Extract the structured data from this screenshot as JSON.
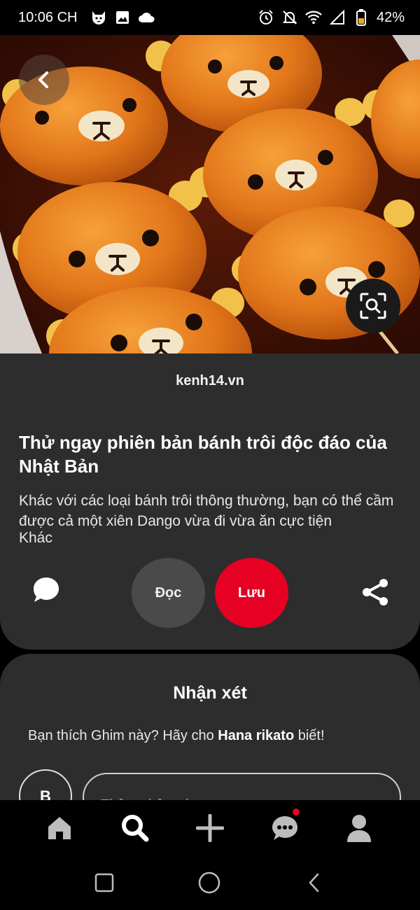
{
  "status_bar": {
    "time": "10:06 CH",
    "battery_percent": "42%",
    "left_icons": [
      "notification-cat-icon",
      "image-icon",
      "cloud-icon"
    ],
    "right_icons": [
      "alarm-icon",
      "bell-off-icon",
      "wifi-icon",
      "signal-icon",
      "battery-icon"
    ]
  },
  "hero": {
    "back_icon": "chevron-left-icon",
    "visual_search_icon": "visual-search-icon"
  },
  "pin": {
    "source": "kenh14.vn",
    "title": "Thử ngay phiên bản bánh trôi độc đáo của Nhật Bản",
    "description": "Khác với các loại bánh trôi thông thường, bạn có thể cầm được cả một xiên Dango vừa đi vừa ăn cực tiện",
    "category": "Khác"
  },
  "actions": {
    "read_label": "Đọc",
    "save_label": "Lưu",
    "comment_icon": "comment-bubble-icon",
    "share_icon": "share-icon"
  },
  "comments": {
    "title": "Nhận xét",
    "prompt_prefix": "Bạn thích Ghim này? Hãy cho ",
    "prompt_user": "Hana rikato",
    "prompt_suffix": " biết!",
    "avatar_initial": "B",
    "input_placeholder": "Thêm nhận xét"
  },
  "bottom_nav": {
    "items": [
      "home-icon",
      "search-icon",
      "add-icon",
      "messages-icon",
      "profile-icon"
    ],
    "active": "search-icon"
  },
  "system_nav": {
    "items": [
      "recents-icon",
      "home-circle-icon",
      "back-icon"
    ]
  },
  "colors": {
    "accent": "#e60023",
    "card_background": "#2d2d2d",
    "page_background": "#000000"
  }
}
